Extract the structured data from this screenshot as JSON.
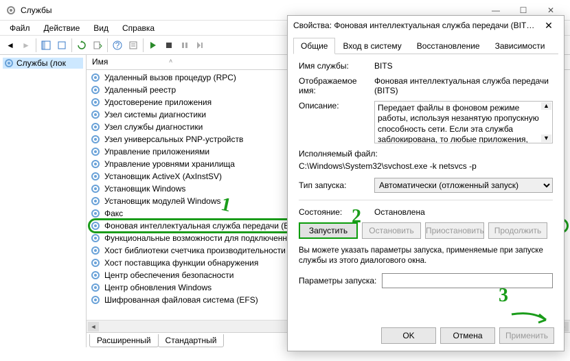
{
  "window": {
    "title": "Службы",
    "win_min": "—",
    "win_max": "☐",
    "win_close": "✕"
  },
  "menu": {
    "file": "Файл",
    "action": "Действие",
    "view": "Вид",
    "help": "Справка"
  },
  "left": {
    "label": "Службы (лок"
  },
  "column": {
    "name": "Имя",
    "sort": "˄"
  },
  "services": [
    "Удаленный вызов процедур (RPC)",
    "Удаленный реестр",
    "Удостоверение приложения",
    "Узел системы диагностики",
    "Узел службы диагностики",
    "Узел универсальных PNP-устройств",
    "Управление приложениями",
    "Управление уровнями хранилища",
    "Установщик ActiveX (AxInstSV)",
    "Установщик Windows",
    "Установщик модулей Windows",
    "Факс",
    "Фоновая интеллектуальная служба передачи (BITS)",
    "Функциональные возможности для подключенны...",
    "Хост библиотеки счетчика производительности",
    "Хост поставщика функции обнаружения",
    "Центр обеспечения безопасности",
    "Центр обновления Windows",
    "Шифрованная файловая система (EFS)"
  ],
  "tabs": {
    "extended": "Расширенный",
    "standard": "Стандартный"
  },
  "dialog": {
    "title": "Свойства: Фоновая интеллектуальная служба передачи (BITS) (...",
    "close": "✕",
    "tabs": {
      "general": "Общие",
      "logon": "Вход в систему",
      "recovery": "Восстановление",
      "deps": "Зависимости"
    },
    "svc_name_lbl": "Имя службы:",
    "svc_name": "BITS",
    "disp_lbl": "Отображаемое имя:",
    "disp_val": "Фоновая интеллектуальная служба передачи (BITS)",
    "desc_lbl": "Описание:",
    "desc_val": "Передает файлы в фоновом режиме работы, используя незанятую пропускную способность сети. Если эта служба заблокирована, то любые приложения, зависящие от BITS, такие",
    "exe_lbl": "Исполняемый файл:",
    "exe_val": "C:\\Windows\\System32\\svchost.exe -k netsvcs -p",
    "start_lbl": "Тип запуска:",
    "start_val": "Автоматически (отложенный запуск)",
    "state_lbl": "Состояние:",
    "state_val": "Остановлена",
    "btn_start": "Запустить",
    "btn_stop": "Остановить",
    "btn_pause": "Приостановить",
    "btn_resume": "Продолжить",
    "note": "Вы можете указать параметры запуска, применяемые при запуске службы из этого диалогового окна.",
    "params_lbl": "Параметры запуска:",
    "ok": "OK",
    "cancel": "Отмена",
    "apply": "Применить"
  },
  "ann": {
    "one": "1",
    "two": "2",
    "three": "3"
  }
}
